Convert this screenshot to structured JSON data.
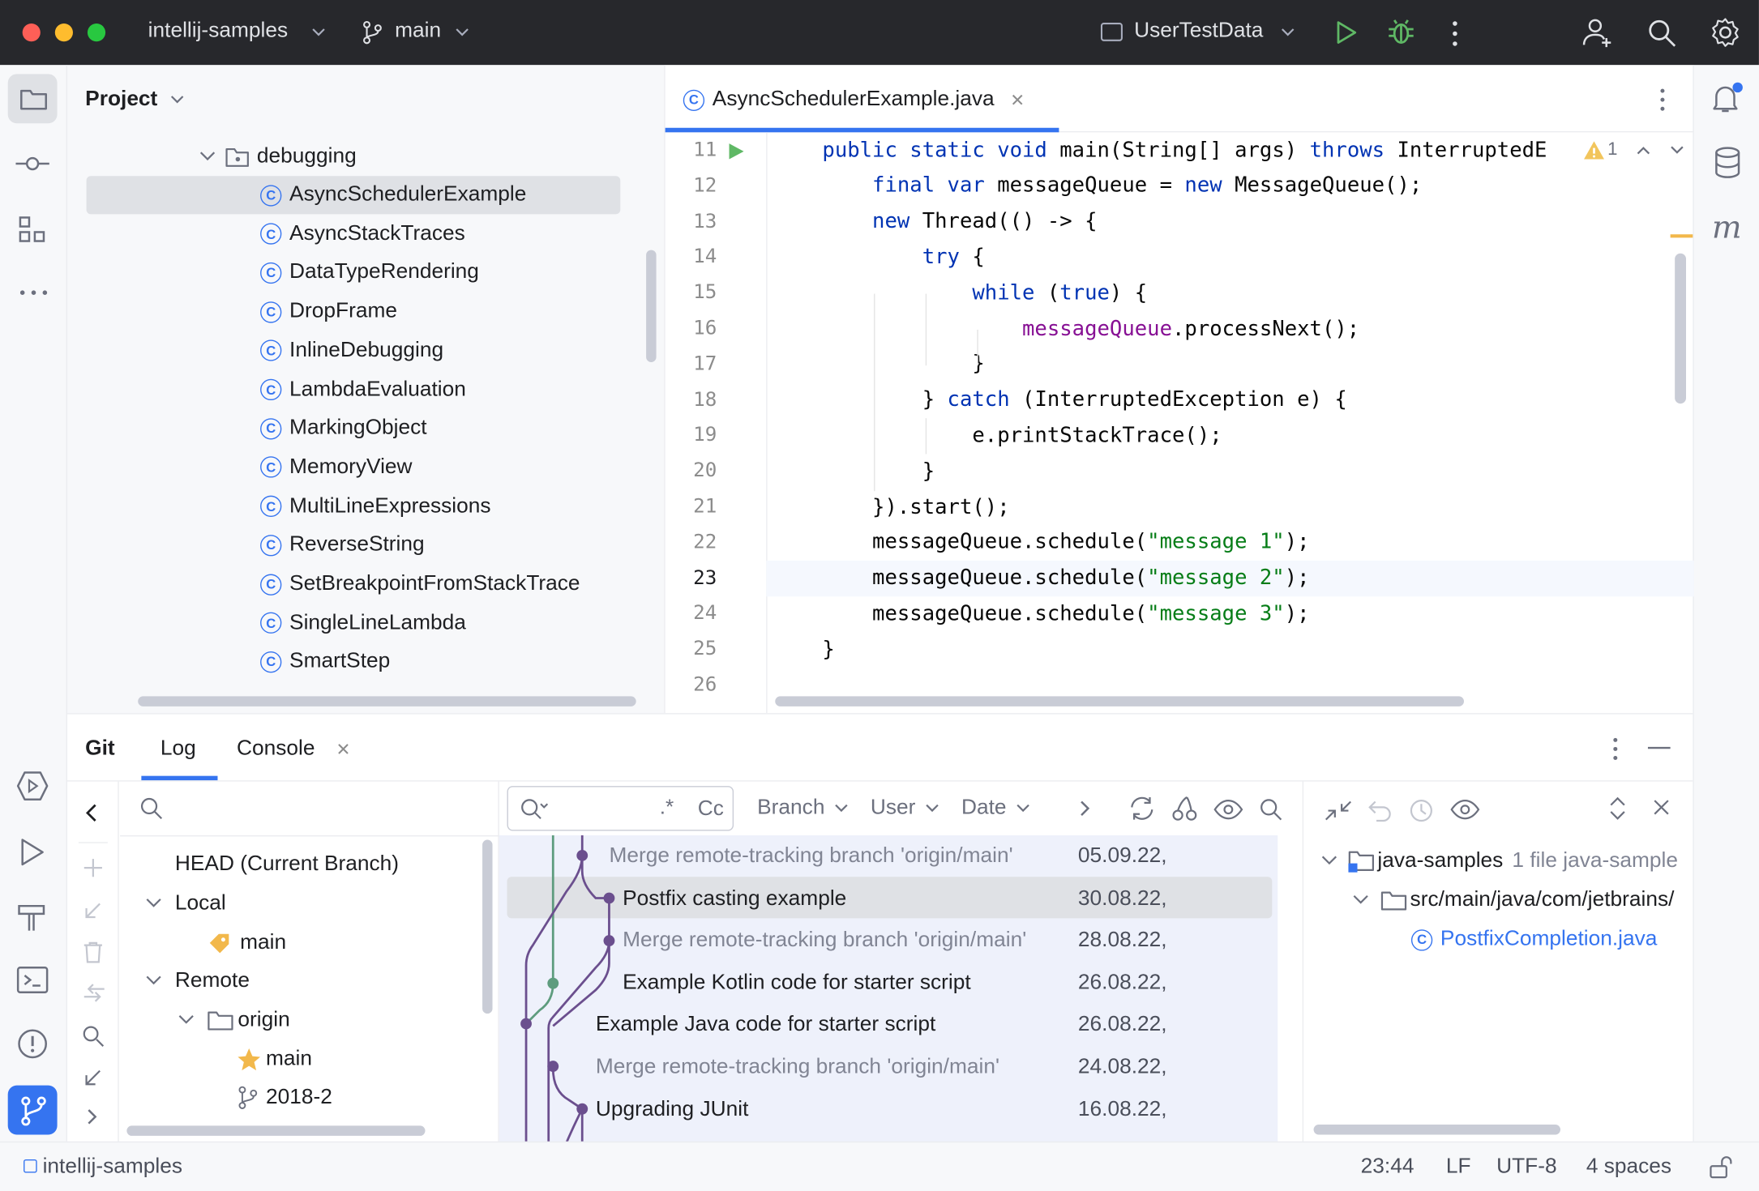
{
  "window": {
    "project": "intellij-samples",
    "branch": "main",
    "run_config": "UserTestData"
  },
  "project_panel": {
    "title": "Project",
    "folder": "debugging",
    "files": [
      "AsyncSchedulerExample",
      "AsyncStackTraces",
      "DataTypeRendering",
      "DropFrame",
      "InlineDebugging",
      "LambdaEvaluation",
      "MarkingObject",
      "MemoryView",
      "MultiLineExpressions",
      "ReverseString",
      "SetBreakpointFromStackTrace",
      "SingleLineLambda",
      "SmartStep"
    ],
    "selected": "AsyncSchedulerExample"
  },
  "editor": {
    "tab": "AsyncSchedulerExample.java",
    "warnings": "1",
    "current_line": "23",
    "line_numbers": [
      "11",
      "12",
      "13",
      "14",
      "15",
      "16",
      "17",
      "18",
      "19",
      "20",
      "21",
      "22",
      "23",
      "24",
      "25",
      "26"
    ],
    "lines": [
      [
        {
          "t": "public static void ",
          "c": "kw"
        },
        {
          "t": "main",
          "c": "plain"
        },
        {
          "t": "(String[] args) ",
          "c": "plain"
        },
        {
          "t": "throws ",
          "c": "kw"
        },
        {
          "t": "InterruptedE",
          "c": "plain"
        }
      ],
      [
        {
          "t": "    final var ",
          "c": "kw"
        },
        {
          "t": "messageQueue = ",
          "c": "plain"
        },
        {
          "t": "new ",
          "c": "kw"
        },
        {
          "t": "MessageQueue();",
          "c": "plain"
        }
      ],
      [
        {
          "t": "    new ",
          "c": "kw"
        },
        {
          "t": "Thread(() -> {",
          "c": "plain"
        }
      ],
      [
        {
          "t": "        try ",
          "c": "kw"
        },
        {
          "t": "{",
          "c": "plain"
        }
      ],
      [
        {
          "t": "            while ",
          "c": "kw"
        },
        {
          "t": "(",
          "c": "plain"
        },
        {
          "t": "true",
          "c": "kw"
        },
        {
          "t": ") {",
          "c": "plain"
        }
      ],
      [
        {
          "t": "                messageQueue",
          "c": "fld"
        },
        {
          "t": ".processNext();",
          "c": "plain"
        }
      ],
      [
        {
          "t": "            }",
          "c": "plain"
        }
      ],
      [
        {
          "t": "        } ",
          "c": "plain"
        },
        {
          "t": "catch ",
          "c": "kw"
        },
        {
          "t": "(InterruptedException e) {",
          "c": "plain"
        }
      ],
      [
        {
          "t": "            e.printStackTrace();",
          "c": "plain"
        }
      ],
      [
        {
          "t": "        }",
          "c": "plain"
        }
      ],
      [
        {
          "t": "    }).start();",
          "c": "plain"
        }
      ],
      [
        {
          "t": "    messageQueue.schedule(",
          "c": "plain"
        },
        {
          "t": "\"message 1\"",
          "c": "str"
        },
        {
          "t": ");",
          "c": "plain"
        }
      ],
      [
        {
          "t": "    messageQueue.schedule(",
          "c": "plain"
        },
        {
          "t": "\"message 2\"",
          "c": "str"
        },
        {
          "t": ");",
          "c": "plain"
        }
      ],
      [
        {
          "t": "    messageQueue.schedule(",
          "c": "plain"
        },
        {
          "t": "\"message 3\"",
          "c": "str"
        },
        {
          "t": ");",
          "c": "plain"
        }
      ],
      [
        {
          "t": "}",
          "c": "plain"
        }
      ],
      []
    ]
  },
  "git": {
    "tool": "Git",
    "tabs": [
      "Log",
      "Console"
    ],
    "branches": {
      "head": "HEAD (Current Branch)",
      "local_label": "Local",
      "local": [
        "main"
      ],
      "remote_label": "Remote",
      "remote_name": "origin",
      "remote_branches": [
        "main",
        "2018-2"
      ]
    },
    "filters": {
      "branch": "Branch",
      "user": "User",
      "date": "Date",
      "regex": ".*",
      "case": "Cc"
    },
    "commits": [
      {
        "msg": "Merge remote-tracking branch 'origin/main'",
        "date": "05.09.22,",
        "muted": true
      },
      {
        "msg": "Postfix casting example",
        "date": "30.08.22,",
        "muted": false
      },
      {
        "msg": "Merge remote-tracking branch 'origin/main'",
        "date": "28.08.22,",
        "muted": true
      },
      {
        "msg": "Example Kotlin code for starter script",
        "date": "26.08.22,",
        "muted": false
      },
      {
        "msg": "Example Java code for starter script",
        "date": "26.08.22,",
        "muted": false
      },
      {
        "msg": "Merge remote-tracking branch 'origin/main'",
        "date": "24.08.22,",
        "muted": true
      },
      {
        "msg": "Upgrading JUnit",
        "date": "16.08.22,",
        "muted": false
      }
    ],
    "changes": {
      "root": "java-samples",
      "root_meta": "1 file  java-sample",
      "path": "src/main/java/com/jetbrains/",
      "file": "PostfixCompletion.java"
    }
  },
  "status": {
    "project": "intellij-samples",
    "position": "23:44",
    "line_sep": "LF",
    "encoding": "UTF-8",
    "indent": "4 spaces"
  }
}
